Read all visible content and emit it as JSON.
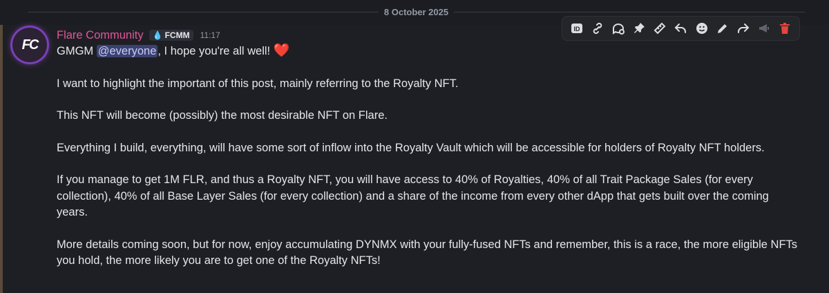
{
  "date_divider": "8 October 2025",
  "message": {
    "avatar_text": "FC",
    "author": "Flare Community",
    "tag": "FCMM",
    "time": "11:17",
    "greeting_start": "GMGM ",
    "mention": "@everyone",
    "greeting_end": ", I hope you're all well! ",
    "heart": "❤️",
    "paragraphs": [
      "I want to highlight the important of this post, mainly referring to the Royalty NFT.",
      "This NFT will become (possibly) the most desirable NFT on Flare.",
      "Everything I build, everything, will have some sort of inflow into the Royalty Vault which will be accessible for holders of Royalty NFT holders.",
      "If you manage to get 1M FLR, and thus a Royalty NFT, you will have access to 40% of Royalties, 40% of all Trait Package Sales (for every collection), 40% of all Base Layer Sales (for every collection) and a share of the income from every other dApp that gets built over the coming years.",
      "More details coming soon, but for now, enjoy accumulating DYNMX with your fully-fused NFTs and remember, this is a race, the more eligible NFTs you hold, the more likely you are to get one of the Royalty NFTs!"
    ]
  },
  "toolbar": {
    "icons": [
      "id-icon",
      "link-icon",
      "thread-icon",
      "pin-icon",
      "ruler-icon",
      "reply-icon",
      "emoji-icon",
      "edit-icon",
      "forward-icon",
      "megaphone-icon",
      "trash-icon"
    ],
    "id_label": "ID"
  },
  "colors": {
    "username": "#e0569a",
    "mention_bg": "#3c4270",
    "danger": "#e5453d"
  }
}
